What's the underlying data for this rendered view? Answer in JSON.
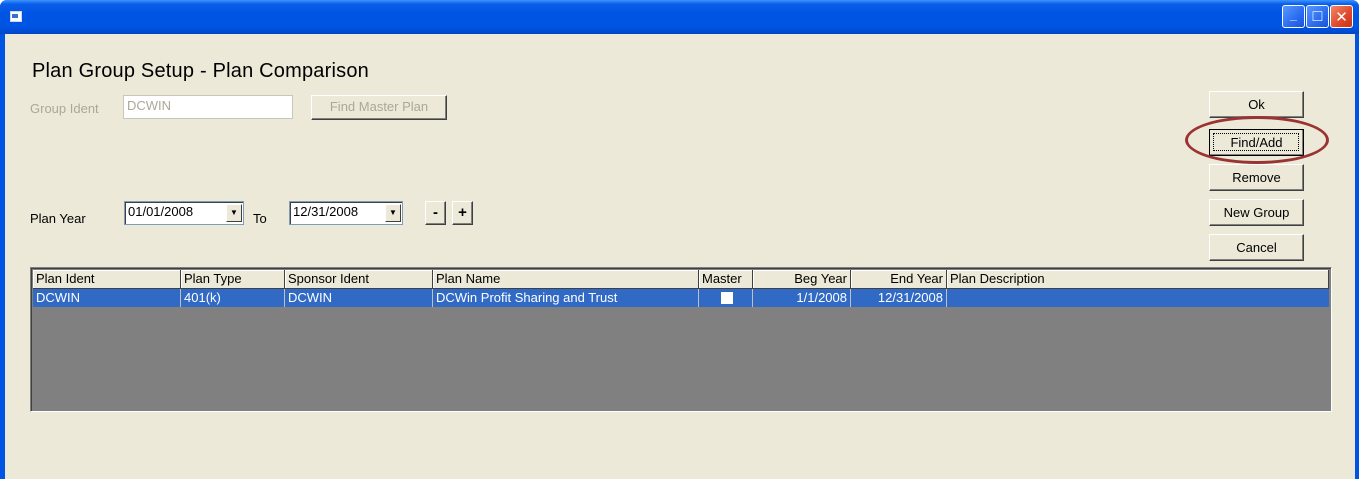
{
  "window": {
    "title": "",
    "controls": {
      "minimize": "_",
      "maximize": "□",
      "close": "✕"
    }
  },
  "form": {
    "heading": "Plan Group Setup - Plan Comparison",
    "group_ident_label": "Group Ident",
    "group_ident_value": "DCWIN",
    "find_master_plan_label": "Find Master Plan",
    "plan_year_label": "Plan Year",
    "plan_year_from": "01/01/2008",
    "to_label": "To",
    "plan_year_to": "12/31/2008",
    "minus_label": "-",
    "plus_label": "+"
  },
  "buttons": {
    "ok": "Ok",
    "find_add": "Find/Add",
    "remove": "Remove",
    "new_group": "New Group",
    "cancel": "Cancel"
  },
  "grid": {
    "columns": [
      "Plan Ident",
      "Plan Type",
      "Sponsor Ident",
      "Plan Name",
      "Master",
      "Beg Year",
      "End Year",
      "Plan Description"
    ],
    "rows": [
      {
        "plan_ident": "DCWIN",
        "plan_type": "401(k)",
        "sponsor_ident": "DCWIN",
        "plan_name": "DCWin Profit Sharing and Trust",
        "master": false,
        "beg_year": "1/1/2008",
        "end_year": "12/31/2008",
        "plan_description": ""
      }
    ]
  },
  "colors": {
    "title_bar": "#0054e3",
    "face": "#ece9d8",
    "selection": "#316ac5",
    "annotation": "#9b3333"
  }
}
